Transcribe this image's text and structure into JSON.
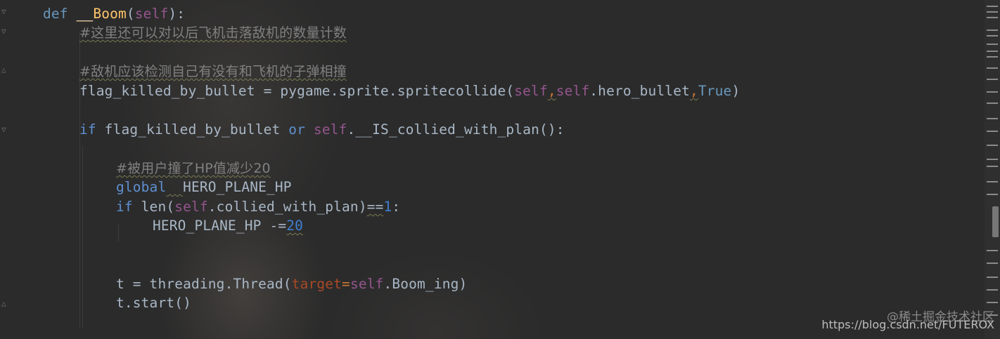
{
  "code": {
    "line1": {
      "def": "def ",
      "name_ul": "__",
      "name": "Boom",
      "open": "(",
      "self": "self",
      "close": "):"
    },
    "line2": {
      "comment": "#这里还可以对以后飞机击落敌机的数量计数"
    },
    "line4": {
      "comment": "#敌机应该检测自己有没有和飞机的子弹相撞"
    },
    "line5": {
      "a": "flag_killed_by_bullet = pygame.sprite.spritecollide(",
      "self1": "self",
      "comma1": ",",
      "self2": "self",
      "b": ".hero_bullet",
      "comma2": ",",
      "tru": "True",
      "close": ")"
    },
    "line7": {
      "if": "if",
      "a": " flag_killed_by_bullet ",
      "or": "or",
      "sp": " ",
      "self": "self",
      "b": ".__IS_collied_with_plan():"
    },
    "line9": {
      "comment": "#被用户撞了HP值减少20"
    },
    "line10": {
      "global": "global",
      "sp": "  ",
      "name": "HERO_PLANE_HP"
    },
    "line11": {
      "if": "if",
      "a": " len(",
      "self": "self",
      "b": ".collied_with_plan)",
      "eq": "==",
      "num": "1",
      "colon": ":"
    },
    "line12": {
      "a": "HERO_PLANE_HP -=",
      "num": "20"
    },
    "line15": {
      "a": "t = threading.Thread(",
      "param": "target",
      "eq": "=",
      "self": "self",
      "b": ".Boom_ing)"
    },
    "line16": {
      "a": "t.start()"
    }
  },
  "watermark": {
    "site": "@稀土掘金技术社区",
    "url": "https://blog.csdn.net/FUTEROX"
  },
  "colors": {
    "background": "#2b2b2b",
    "keyword": "#cc7832",
    "self": "#94558d",
    "function": "#ffc66d",
    "comment": "#808080",
    "number": "#3f7fd0",
    "text": "#a9b7c6"
  },
  "icons": [
    "fold-marker-icon",
    "scroll-marker-icon"
  ]
}
